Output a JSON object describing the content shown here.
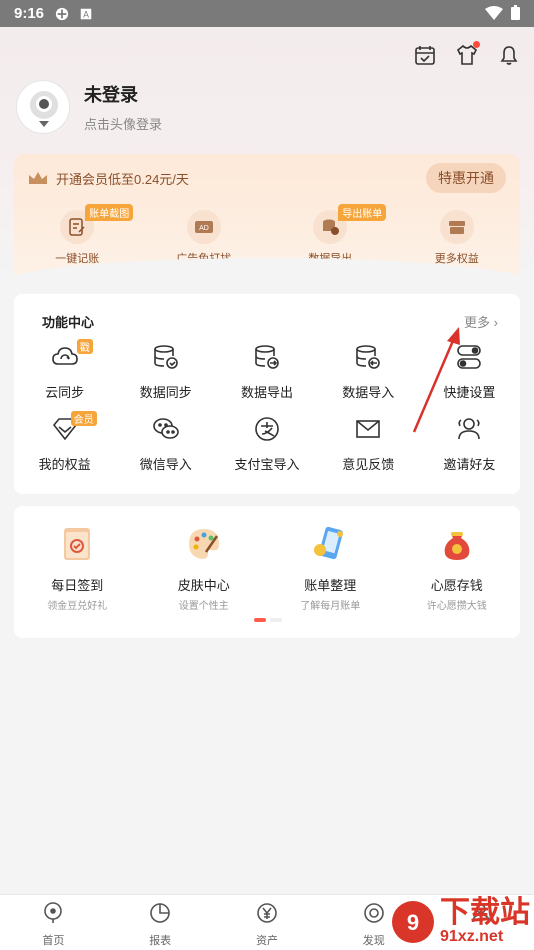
{
  "status": {
    "time": "9:16"
  },
  "profile": {
    "name": "未登录",
    "hint": "点击头像登录"
  },
  "vip": {
    "text": "开通会员低至0.24元/天",
    "button": "特惠开通",
    "items": [
      {
        "label": "一键记账",
        "tag": "账单截图",
        "icon": "note-edit-icon"
      },
      {
        "label": "广告免打扰",
        "tag": "",
        "icon": "ad-block-icon"
      },
      {
        "label": "数据导出",
        "tag": "导出账单",
        "icon": "data-export-icon"
      },
      {
        "label": "更多权益",
        "tag": "",
        "icon": "more-benefits-icon"
      }
    ]
  },
  "functions": {
    "title": "功能中心",
    "more": "更多",
    "items": [
      {
        "label": "云同步",
        "tag": "戳",
        "icon": "cloud-sync-icon"
      },
      {
        "label": "数据同步",
        "tag": "",
        "icon": "database-check-icon"
      },
      {
        "label": "数据导出",
        "tag": "",
        "icon": "database-export-icon"
      },
      {
        "label": "数据导入",
        "tag": "",
        "icon": "database-import-icon"
      },
      {
        "label": "快捷设置",
        "tag": "",
        "icon": "toggle-icon"
      },
      {
        "label": "我的权益",
        "tag": "会员",
        "icon": "diamond-icon"
      },
      {
        "label": "微信导入",
        "tag": "",
        "icon": "wechat-icon"
      },
      {
        "label": "支付宝导入",
        "tag": "",
        "icon": "alipay-icon"
      },
      {
        "label": "意见反馈",
        "tag": "",
        "icon": "mail-icon"
      },
      {
        "label": "邀请好友",
        "tag": "",
        "icon": "friends-icon"
      }
    ]
  },
  "promos": [
    {
      "title": "每日签到",
      "sub": "领金豆兑好礼",
      "icon": "calendar-sign-icon"
    },
    {
      "title": "皮肤中心",
      "sub": "设置个性主",
      "icon": "palette-icon"
    },
    {
      "title": "账单整理",
      "sub": "了解每月账单",
      "icon": "bill-phone-icon"
    },
    {
      "title": "心愿存钱",
      "sub": "许心愿攒大钱",
      "icon": "money-bag-icon"
    }
  ],
  "tabs": [
    {
      "label": "首页",
      "icon": "home-icon"
    },
    {
      "label": "报表",
      "icon": "pie-chart-icon"
    },
    {
      "label": "资产",
      "icon": "yen-icon"
    },
    {
      "label": "发现",
      "icon": "discover-icon"
    },
    {
      "label": "",
      "icon": "profile-icon"
    }
  ],
  "watermark": {
    "line1": "下载站",
    "line2": "91xz.net"
  },
  "colors": {
    "accent": "#ff5a4a",
    "gold": "#8a4f2a",
    "tag": "#f6a53b"
  }
}
